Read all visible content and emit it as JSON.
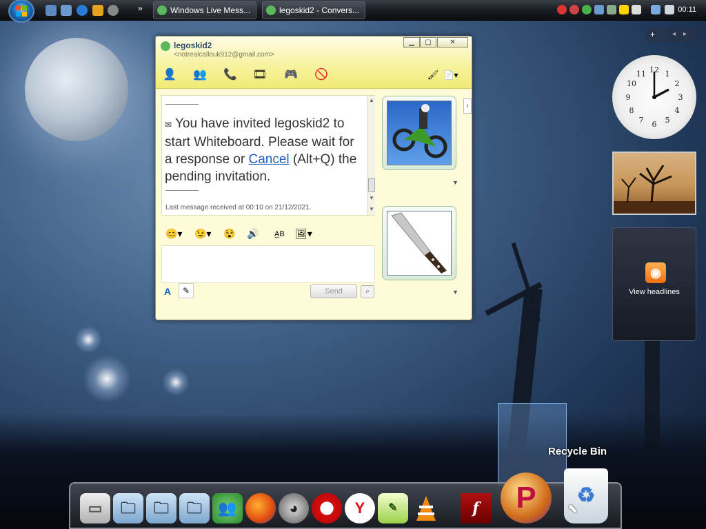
{
  "taskbar": {
    "tasks": [
      {
        "label": "Windows Live Mess...",
        "icon": "messenger-icon"
      },
      {
        "label": "legoskid2 - Convers...",
        "icon": "conversation-icon"
      }
    ],
    "overflow": "»",
    "clock": "00:11"
  },
  "messenger": {
    "contact_name": "legoskid2",
    "contact_email": "<notrealcallouk912@gmail.com>",
    "window_controls": {
      "minimize": "▁",
      "maximize": "▢",
      "close": "✕"
    },
    "message": {
      "invite_before_link": "You have invited legoskid2 to start Whiteboard. Please wait for a response or ",
      "link": "Cancel",
      "invite_after_link": " (Alt+Q) the pending invitation.",
      "last_message": "Last message received at 00:10 on 21/12/2021."
    },
    "send_label": "Send"
  },
  "gadgets": {
    "feed_label": "View headlines",
    "toolbar": {
      "add": "+",
      "prev": "◂",
      "next": "▸"
    }
  },
  "desktop": {
    "recycle_bin_label": "Recycle Bin"
  },
  "dock": {
    "items": [
      "presentation-icon",
      "folder-icon",
      "pictures-folder-icon",
      "documents-folder-icon",
      "messenger-icon",
      "firefox-icon",
      "raccoon-icon",
      "opera-icon",
      "yandex-icon",
      "notepad-icon",
      "vlc-icon",
      "flash-icon",
      "p-app-icon",
      "recycle-bin-icon"
    ]
  },
  "colors": {
    "msn_header": "#f7f29c",
    "link": "#1f5fbf",
    "taskbar": "#1a1d22"
  }
}
